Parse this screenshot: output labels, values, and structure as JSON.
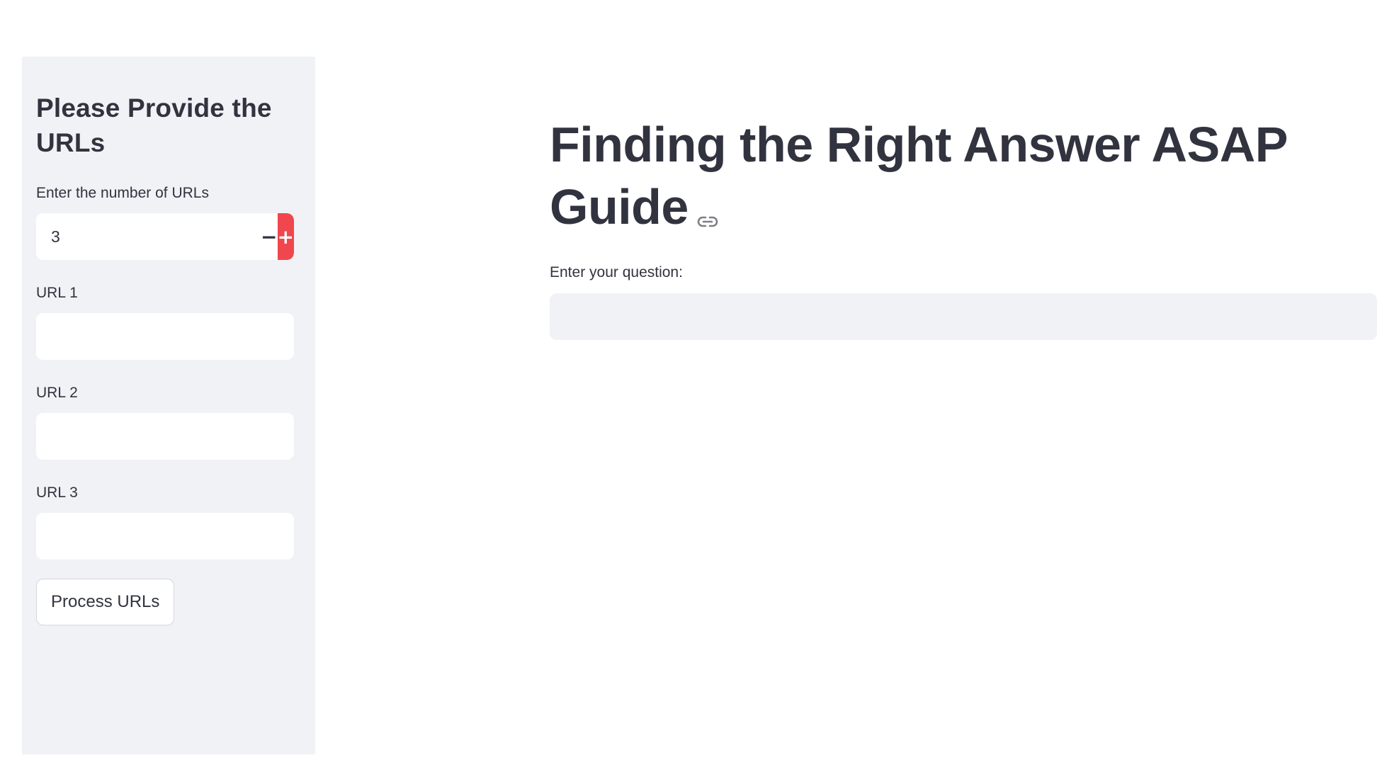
{
  "sidebar": {
    "title": "Please Provide the URLs",
    "number_label": "Enter the number of URLs",
    "number_value": "3",
    "decrement_label": "−",
    "increment_label": "+",
    "url_fields": [
      {
        "label": "URL 1",
        "value": ""
      },
      {
        "label": "URL 2",
        "value": ""
      },
      {
        "label": "URL 3",
        "value": ""
      }
    ],
    "process_button_label": "Process URLs"
  },
  "main": {
    "title": "Finding the Right Answer ASAP Guide",
    "question_label": "Enter your question:",
    "question_value": ""
  },
  "colors": {
    "sidebar_bg": "#f0f2f6",
    "accent": "#ef474d",
    "text": "#31333f"
  },
  "icons": {
    "anchor": "link-icon"
  }
}
